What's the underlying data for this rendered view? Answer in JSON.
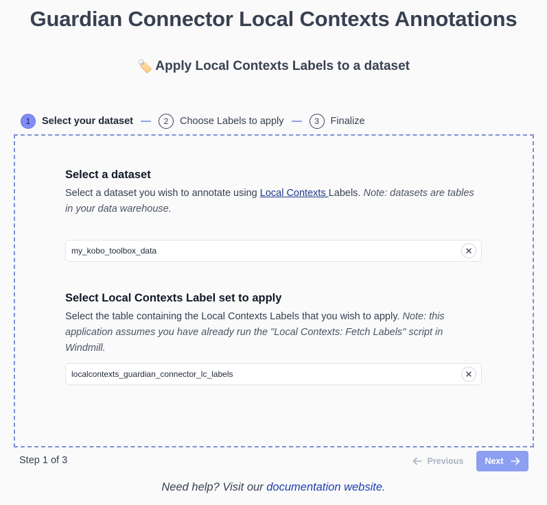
{
  "header": {
    "title": "Guardian Connector Local Contexts Annotations",
    "subtitle": "Apply Local Contexts Labels to a dataset",
    "subtitle_icon": "🏷️"
  },
  "stepper": {
    "steps": [
      {
        "number": "1",
        "label": "Select your dataset",
        "active": true
      },
      {
        "number": "2",
        "label": "Choose Labels to apply",
        "active": false
      },
      {
        "number": "3",
        "label": "Finalize",
        "active": false
      }
    ]
  },
  "dataset_section": {
    "title": "Select a dataset",
    "desc_before": "Select a dataset you wish to annotate using ",
    "desc_link": "Local Contexts ",
    "desc_after": "Labels. ",
    "desc_note": "Note: datasets are tables in your data warehouse.",
    "value": "my_kobo_toolbox_data"
  },
  "labelset_section": {
    "title": "Select Local Contexts Label set to apply",
    "desc": "Select the table containing the Local Contexts Labels that you wish to apply. ",
    "desc_note": "Note: this application assumes you have already run the \"Local Contexts: Fetch Labels\" script in Windmill.",
    "value": "localcontexts_guardian_connector_lc_labels"
  },
  "footer": {
    "step_counter": "Step 1 of 3",
    "previous_label": "Previous",
    "next_label": "Next",
    "help_before": "Need help? Visit our ",
    "help_link": "documentation website",
    "help_after": "."
  },
  "colors": {
    "accent": "#818cf8",
    "next_button": "#8c9ff0",
    "panel_border": "#7d8fd4",
    "link": "#1e40af"
  }
}
